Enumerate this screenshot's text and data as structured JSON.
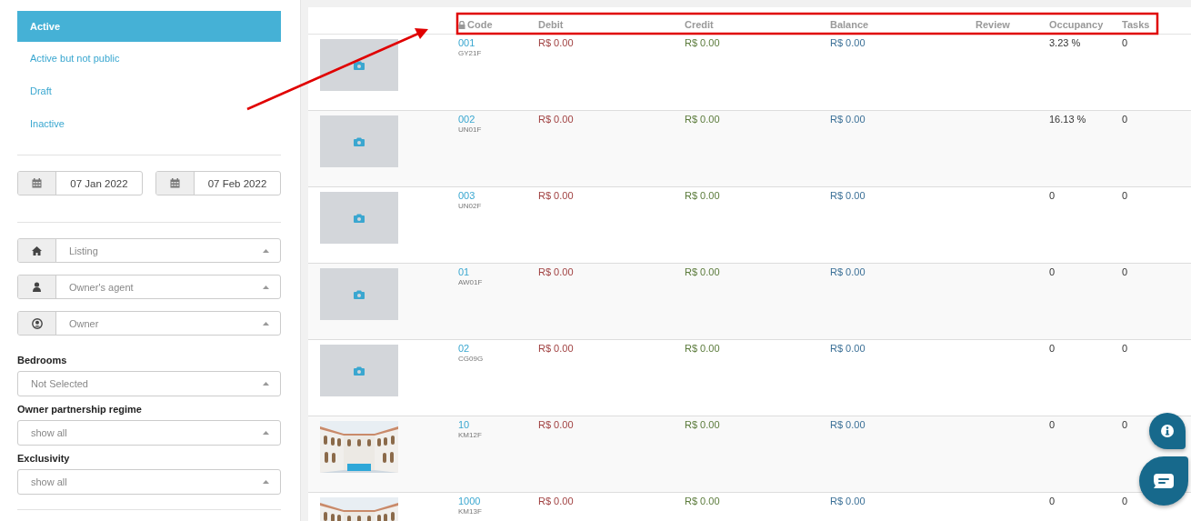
{
  "status_tabs": [
    {
      "label": "Active",
      "selected": true
    },
    {
      "label": "Active but not public",
      "selected": false
    },
    {
      "label": "Draft",
      "selected": false
    },
    {
      "label": "Inactive",
      "selected": false
    }
  ],
  "date_range": [
    {
      "value": "07 Jan 2022"
    },
    {
      "value": "07 Feb 2022"
    }
  ],
  "filters": [
    {
      "kind": "icon",
      "placeholder": "Listing"
    },
    {
      "kind": "icon",
      "placeholder": "Owner's agent"
    },
    {
      "kind": "icon",
      "placeholder": "Owner"
    },
    {
      "kind": "labeled",
      "label": "Bedrooms",
      "placeholder": "Not Selected"
    },
    {
      "kind": "labeled",
      "label": "Owner partnership regime",
      "placeholder": "show all"
    },
    {
      "kind": "labeled",
      "label": "Exclusivity",
      "placeholder": "show all"
    }
  ],
  "table": {
    "columns": [
      {
        "label": "Code",
        "locked": true
      },
      {
        "label": "Debit",
        "locked": false
      },
      {
        "label": "Credit",
        "locked": false
      },
      {
        "label": "Balance",
        "locked": false
      },
      {
        "label": "Review",
        "locked": false
      },
      {
        "label": "Occupancy",
        "locked": false
      },
      {
        "label": "Tasks",
        "locked": false
      }
    ],
    "rows": [
      {
        "kind": "placeholder",
        "code": "001",
        "unit": "GY21F",
        "debit": "R$ 0.00",
        "credit": "R$ 0.00",
        "balance": "R$ 0.00",
        "occupancy": "3.23 %",
        "tasks": "0"
      },
      {
        "kind": "placeholder",
        "code": "002",
        "unit": "UN01F",
        "debit": "R$ 0.00",
        "credit": "R$ 0.00",
        "balance": "R$ 0.00",
        "occupancy": "16.13 %",
        "tasks": "0"
      },
      {
        "kind": "placeholder",
        "code": "003",
        "unit": "UN02F",
        "debit": "R$ 0.00",
        "credit": "R$ 0.00",
        "balance": "R$ 0.00",
        "occupancy": "0",
        "tasks": "0"
      },
      {
        "kind": "placeholder",
        "code": "01",
        "unit": "AW01F",
        "debit": "R$ 0.00",
        "credit": "R$ 0.00",
        "balance": "R$ 0.00",
        "occupancy": "0",
        "tasks": "0"
      },
      {
        "kind": "placeholder",
        "code": "02",
        "unit": "CG09G",
        "debit": "R$ 0.00",
        "credit": "R$ 0.00",
        "balance": "R$ 0.00",
        "occupancy": "0",
        "tasks": "0"
      },
      {
        "kind": "picture",
        "code": "10",
        "unit": "KM12F",
        "debit": "R$ 0.00",
        "credit": "R$ 0.00",
        "balance": "R$ 0.00",
        "occupancy": "0",
        "tasks": "0"
      },
      {
        "kind": "picture",
        "code": "1000",
        "unit": "KM13F",
        "debit": "R$ 0.00",
        "credit": "R$ 0.00",
        "balance": "R$ 0.00",
        "occupancy": "0",
        "tasks": "0"
      }
    ]
  },
  "annotation": {
    "kind": "arrow-to-frame"
  },
  "floating_buttons": [
    {
      "kind": "info"
    },
    {
      "kind": "chat"
    }
  ]
}
